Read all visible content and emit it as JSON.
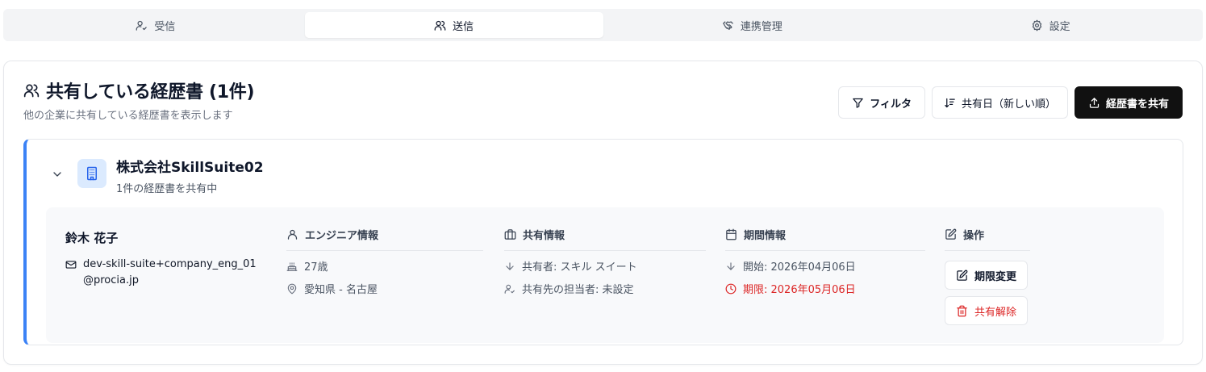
{
  "tabs": [
    {
      "label": "受信",
      "icon": "user-check-icon",
      "active": false
    },
    {
      "label": "送信",
      "icon": "users-icon",
      "active": true
    },
    {
      "label": "連携管理",
      "icon": "handshake-icon",
      "active": false
    },
    {
      "label": "設定",
      "icon": "gear-icon",
      "active": false
    }
  ],
  "header": {
    "title": "共有している経歴書 (1件)",
    "subtitle": "他の企業に共有している経歴書を表示します"
  },
  "toolbar": {
    "filter_label": "フィルタ",
    "sort_label": "共有日（新しい順）",
    "share_label": "経歴書を共有"
  },
  "company": {
    "name": "株式会社SkillSuite02",
    "summary": "1件の経歴書を共有中",
    "accent_color": "#3b82f6"
  },
  "entry": {
    "name": "鈴木 花子",
    "email": "dev-skill-suite+company_eng_01@procia.jp",
    "engineer": {
      "heading": "エンジニア情報",
      "age": "27歳",
      "location": "愛知県 - 名古屋"
    },
    "share": {
      "heading": "共有情報",
      "owner": "共有者: スキル スイート",
      "assignee": "共有先の担当者: 未設定"
    },
    "period": {
      "heading": "期間情報",
      "start": "開始: 2026年04月06日",
      "deadline": "期限: 2026年05月06日",
      "deadline_color": "#dc2626"
    },
    "operations": {
      "heading": "操作",
      "change_label": "期限変更",
      "revoke_label": "共有解除"
    }
  }
}
